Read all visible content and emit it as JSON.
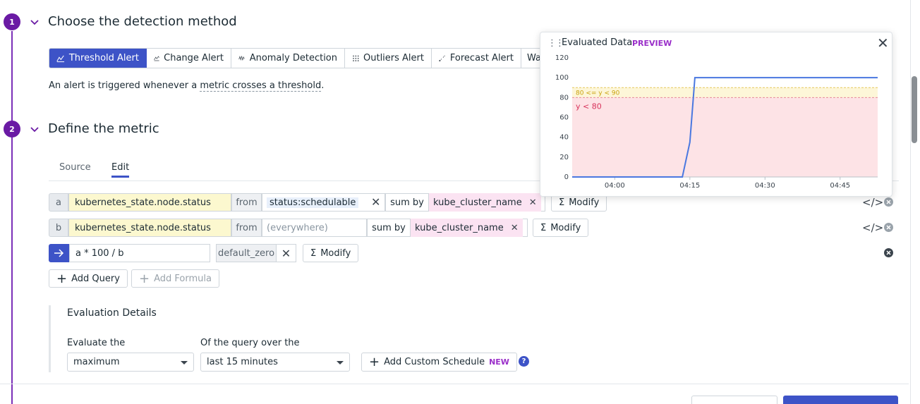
{
  "steps": [
    {
      "num": "1",
      "title": "Choose the detection method"
    },
    {
      "num": "2",
      "title": "Define the metric"
    }
  ],
  "detection_tabs": [
    {
      "label": "Threshold Alert",
      "icon": "threshold-icon",
      "active": true
    },
    {
      "label": "Change Alert",
      "icon": "change-icon",
      "active": false
    },
    {
      "label": "Anomaly Detection",
      "icon": "anomaly-icon",
      "active": false
    },
    {
      "label": "Outliers Alert",
      "icon": "outliers-icon",
      "active": false
    },
    {
      "label": "Forecast Alert",
      "icon": "forecast-icon",
      "active": false
    },
    {
      "label": "Wa",
      "icon": "",
      "active": false
    }
  ],
  "description": {
    "prefix": "An alert is triggered whenever a ",
    "link": "metric crosses a threshold",
    "suffix": "."
  },
  "metric_tabs": {
    "source": "Source",
    "edit": "Edit"
  },
  "queries": [
    {
      "letter": "a",
      "metric": "kubernetes_state.node.status",
      "from_label": "from",
      "from_value": "status:schedulable",
      "sum_label": "sum by",
      "sum_value": "kube_cluster_name",
      "modify": "Modify"
    },
    {
      "letter": "b",
      "metric": "kubernetes_state.node.status",
      "from_label": "from",
      "from_placeholder": "(everywhere)",
      "sum_label": "sum by",
      "sum_value": "kube_cluster_name",
      "modify": "Modify"
    }
  ],
  "formula": {
    "expression": "a * 100 / b",
    "function": "default_zero",
    "modify": "Modify"
  },
  "add_query": "Add Query",
  "add_formula": "Add Formula",
  "evaluation": {
    "title": "Evaluation Details",
    "evaluate_label": "Evaluate the",
    "evaluate_value": "maximum",
    "over_label": "Of the query over the",
    "over_value": "last 15 minutes",
    "custom_schedule": "Add Custom Schedule",
    "new_badge": "NEW",
    "help": "?"
  },
  "popup": {
    "title": "Evaluated Data",
    "badge": "PREVIEW"
  },
  "colors": {
    "accent": "#3d53c7",
    "step": "#6a1aa4",
    "line": "#4a78e0",
    "alert_fill": "#fde3e6",
    "warn_fill": "#fdf6d8"
  },
  "chart_data": {
    "type": "line",
    "x_ticks": [
      "04:00",
      "04:15",
      "04:30",
      "04:45"
    ],
    "y_ticks": [
      0,
      20,
      40,
      60,
      80,
      100,
      120
    ],
    "ylim": [
      0,
      120
    ],
    "x_range_minutes": [
      -8.5,
      52.5
    ],
    "series": [
      {
        "x_minutes": [
          -8.5,
          13.5,
          15,
          16,
          52.5
        ],
        "values": [
          0,
          0,
          35,
          100,
          100
        ]
      }
    ],
    "thresholds": {
      "warning_label": "80 <= y < 90",
      "alert_label": "y < 80",
      "warning_range": [
        80,
        90
      ],
      "alert_range": [
        0,
        80
      ]
    }
  }
}
